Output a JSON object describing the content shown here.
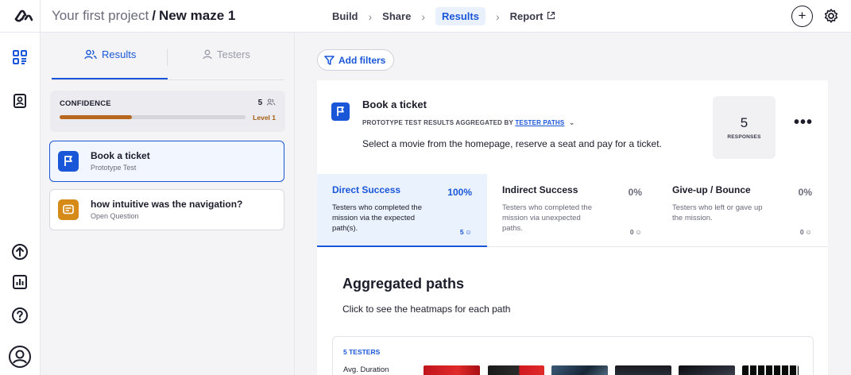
{
  "header": {
    "project_name": "Your first project",
    "separator": "/",
    "maze_name": "New maze 1",
    "steps": [
      "Build",
      "Share",
      "Results",
      "Report"
    ],
    "active_step": "Results",
    "plus_symbol": "+"
  },
  "rail": {
    "icons": [
      "blocks-icon",
      "contacts-icon",
      "upload-icon",
      "analytics-icon",
      "help-icon",
      "profile-icon"
    ]
  },
  "panel": {
    "tabs": {
      "results": "Results",
      "testers": "Testers"
    },
    "confidence": {
      "label": "CONFIDENCE",
      "count": "5",
      "level": "Level 1",
      "progress": 0.39
    },
    "blocks": [
      {
        "title": "Book a ticket",
        "subtitle": "Prototype Test",
        "icon": "flag-icon",
        "color": "#1a56d8"
      },
      {
        "title": "how intuitive was the navigation?",
        "subtitle": "Open Question",
        "icon": "chat-icon",
        "color": "#d68a18"
      }
    ]
  },
  "main": {
    "filter_label": "Add filters",
    "block": {
      "title": "Book a ticket",
      "meta_prefix": "PROTOTYPE TEST RESULTS AGGREGATED BY",
      "meta_link": "TESTER PATHS",
      "description": "Select a movie from the homepage, reserve a seat and pay for a ticket.",
      "responses_count": "5",
      "responses_label": "RESPONSES",
      "more_symbol": "•••"
    },
    "stats": [
      {
        "title": "Direct Success",
        "percent": "100%",
        "description": "Testers who completed the mission via the expected path(s).",
        "count": "5"
      },
      {
        "title": "Indirect Success",
        "percent": "0%",
        "description": "Testers who completed the mission via unexpected paths.",
        "count": "0"
      },
      {
        "title": "Give-up / Bounce",
        "percent": "0%",
        "description": "Testers who left or gave up the mission.",
        "count": "0"
      }
    ],
    "aggregated": {
      "title": "Aggregated paths",
      "subtitle": "Click to see the heatmaps for each path",
      "testers_label": "5 TESTERS",
      "avg_duration_label": "Avg. Duration"
    }
  },
  "colors": {
    "accent": "#1a56d8",
    "confidence_bar": "#b8671e",
    "open_question": "#d68a18"
  }
}
